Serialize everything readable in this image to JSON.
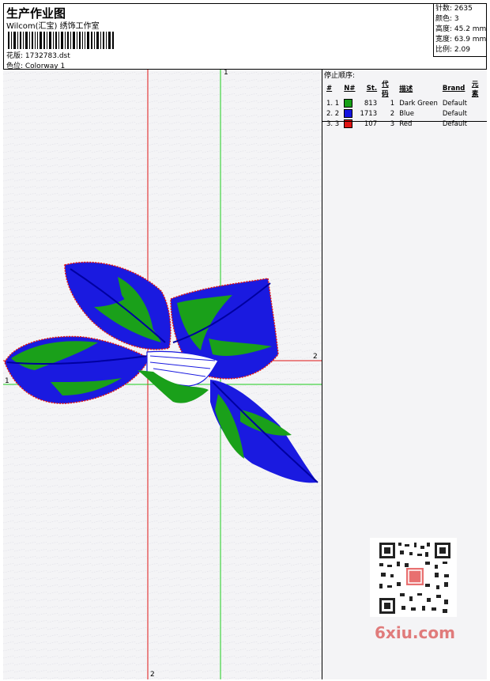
{
  "header": {
    "title": "生产作业图",
    "subtitle": "Wilcom(汇宝) 绣饰工作室",
    "design_label": "花版: 1732783.dst",
    "colorway_label": "色位: Colorway 1"
  },
  "stats": {
    "stitches": "针数: 2635",
    "colors": "颜色: 3",
    "height": "高度: 45.2 mm",
    "width": "宽度: 63.9 mm",
    "scale": "比例: 2.09"
  },
  "stop_sequence": {
    "title": "停止顺序:",
    "headers": [
      "#",
      "N#",
      "St.",
      "代码",
      "描述",
      "Brand",
      "元素"
    ],
    "rows": [
      {
        "idx": "1. 1",
        "color": "#16a016",
        "st": "813",
        "code": "1",
        "desc": "Dark Green",
        "brand": "Default"
      },
      {
        "idx": "2. 2",
        "color": "#1414e0",
        "st": "1713",
        "code": "2",
        "desc": "Blue",
        "brand": "Default"
      },
      {
        "idx": "3. 3",
        "color": "#e01414",
        "st": "107",
        "code": "3",
        "desc": "Red",
        "brand": "Default"
      }
    ]
  },
  "axes": {
    "green_top": "1",
    "green_left": "1",
    "red_right": "2",
    "red_bottom": "2"
  },
  "watermark": "6xiu.com",
  "colors": {
    "green": "#16a016",
    "blue": "#1414e0",
    "red": "#e01414",
    "background": "#f4f4f6"
  }
}
